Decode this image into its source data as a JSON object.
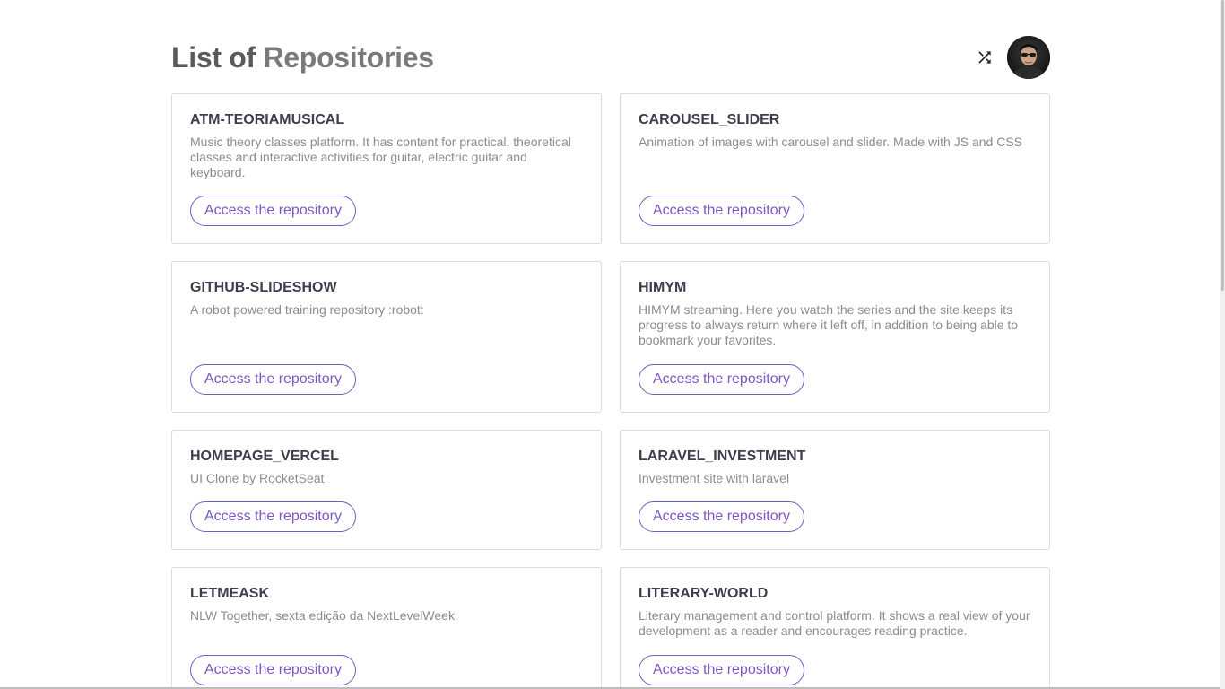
{
  "header": {
    "title_part1": "List of",
    "title_part2": "Repositories",
    "shuffle_icon": "shuffle-icon",
    "avatar_alt": "profile avatar"
  },
  "repositories": [
    {
      "name": "ATM-TEORIAMUSICAL",
      "description": "Music theory classes platform. It has content for practical, theoretical classes and interactive activities for guitar, electric guitar and keyboard.",
      "button_label": "Access the repository"
    },
    {
      "name": "CAROUSEL_SLIDER",
      "description": "Animation of images with carousel and slider. Made with JS and CSS",
      "button_label": "Access the repository"
    },
    {
      "name": "GITHUB-SLIDESHOW",
      "description": "A robot powered training repository :robot:",
      "button_label": "Access the repository"
    },
    {
      "name": "HIMYM",
      "description": "HIMYM streaming. Here you watch the series and the site keeps its progress to always return where it left off, in addition to being able to bookmark your favorites.",
      "button_label": "Access the repository"
    },
    {
      "name": "HOMEPAGE_VERCEL",
      "description": "UI Clone by RocketSeat",
      "button_label": "Access the repository"
    },
    {
      "name": "LARAVEL_INVESTMENT",
      "description": "Investment site with laravel",
      "button_label": "Access the repository"
    },
    {
      "name": "LETMEASK",
      "description": "NLW Together, sexta edição da NextLevelWeek",
      "button_label": "Access the repository"
    },
    {
      "name": "LITERARY-WORLD",
      "description": "Literary management and control platform. It shows a real view of your development as a reader and encourages reading practice.",
      "button_label": "Access the repository"
    }
  ],
  "colors": {
    "accent": "#7e57c2",
    "title": "#3d3d4e",
    "description": "#8c8c8c",
    "border": "#dcdcdc"
  }
}
